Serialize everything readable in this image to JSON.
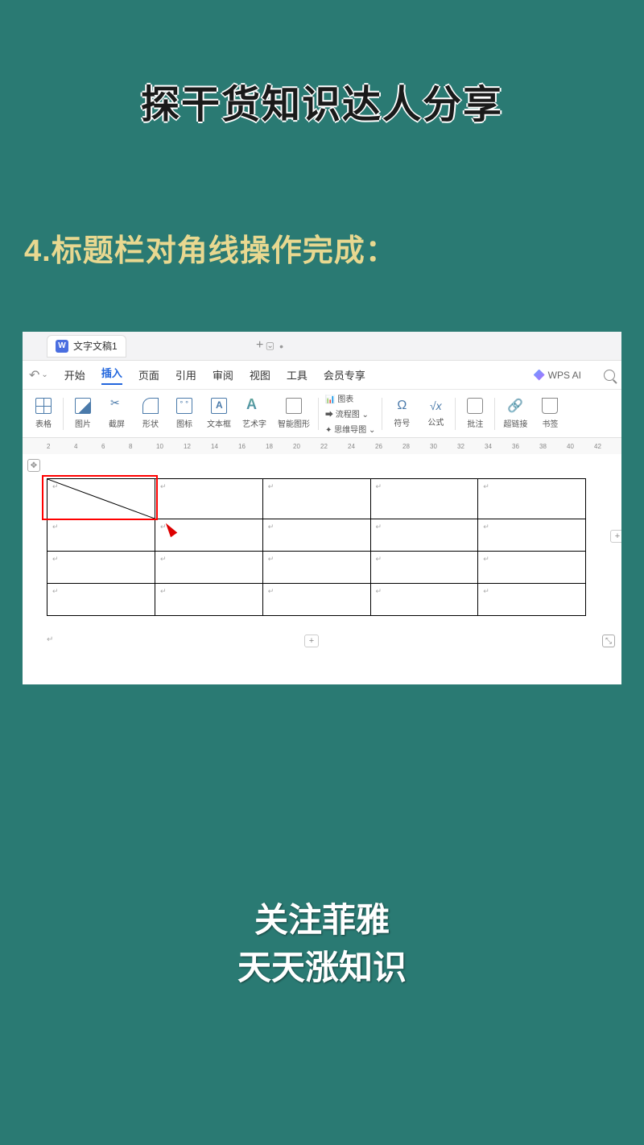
{
  "top_title": "探干货知识达人分享",
  "step_title": "4.标题栏对角线操作完成：",
  "tab": {
    "doc_name": "文字文稿1",
    "w_letter": "W"
  },
  "menu": {
    "items": [
      "开始",
      "插入",
      "页面",
      "引用",
      "审阅",
      "视图",
      "工具",
      "会员专享"
    ],
    "active_index": 1,
    "wps_ai": "WPS AI"
  },
  "ribbon": {
    "items": [
      {
        "label": "表格",
        "dd": true
      },
      {
        "label": "图片",
        "dd": true
      },
      {
        "label": "截屏",
        "dd": true
      },
      {
        "label": "形状",
        "dd": true
      },
      {
        "label": "图标",
        "dd": false
      },
      {
        "label": "文本框",
        "dd": true
      },
      {
        "label": "艺术字",
        "dd": true
      },
      {
        "label": "智能图形",
        "dd": false,
        "pre": "🔶"
      },
      {
        "label": "图表",
        "dd": false,
        "pre": "📊"
      },
      {
        "label": "流程图",
        "dd": true,
        "pre": "🔀"
      },
      {
        "label": "思维导图",
        "dd": true,
        "pre": "🧠"
      },
      {
        "label": "符号",
        "dd": true
      },
      {
        "label": "公式",
        "dd": true
      },
      {
        "label": "批注",
        "dd": false
      },
      {
        "label": "超链接",
        "dd": false
      },
      {
        "label": "书签",
        "dd": false
      }
    ]
  },
  "ruler_marks": [
    2,
    4,
    6,
    8,
    10,
    12,
    14,
    16,
    18,
    20,
    22,
    24,
    26,
    28,
    30,
    32,
    34,
    36,
    38,
    40,
    42
  ],
  "table": {
    "rows": 4,
    "cols": 5
  },
  "bottom": {
    "line1": "关注菲雅",
    "line2": "天天涨知识"
  }
}
